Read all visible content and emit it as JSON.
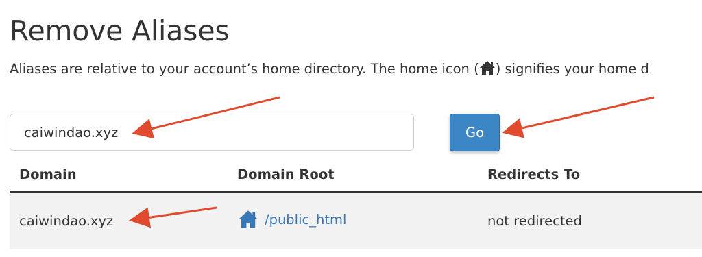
{
  "page": {
    "title": "Remove Aliases",
    "description_before_icon": "Aliases are relative to your account’s home directory. The home icon (",
    "description_after_icon": ") signifies your home d"
  },
  "search": {
    "value": "caiwindao.xyz",
    "go_label": "Go"
  },
  "table": {
    "headers": {
      "domain": "Domain",
      "domain_root": "Domain Root",
      "redirects_to": "Redirects To"
    },
    "rows": [
      {
        "domain": "caiwindao.xyz",
        "domain_root": "/public_html",
        "redirects_to": "not redirected"
      }
    ]
  },
  "icons": {
    "home": "home-icon",
    "annotation_arrow": "arrow-icon"
  },
  "colors": {
    "go_button": "#3d86c6",
    "link": "#3978b8",
    "annotation_arrow": "#e04a2f",
    "row_background": "#f2f2f2"
  }
}
